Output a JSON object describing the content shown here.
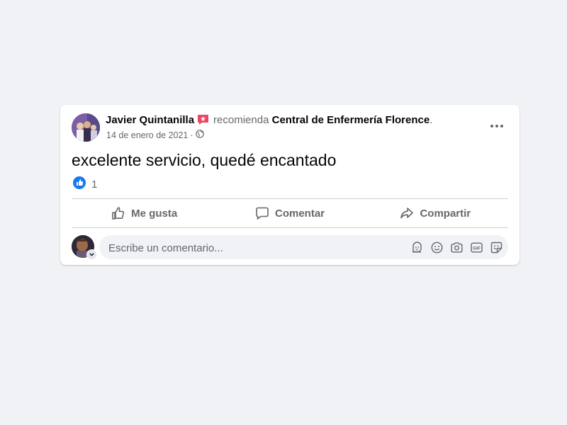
{
  "post": {
    "author": "Javier Quintanilla",
    "verb": "recomienda",
    "page_name": "Central de Enfermería Florence",
    "period": ".",
    "date": "14 de enero de 2021",
    "date_separator": "·",
    "privacy_icon": "globe-icon",
    "text": "excelente servicio, quedé encantado",
    "reaction_icon": "like-icon",
    "reaction_count": "1"
  },
  "actions": {
    "like": "Me gusta",
    "comment": "Comentar",
    "share": "Compartir"
  },
  "comment": {
    "placeholder": "Escribe un comentario...",
    "icons": [
      "avatar-sticker-icon",
      "emoji-icon",
      "camera-icon",
      "gif-icon",
      "sticker-icon"
    ]
  },
  "colors": {
    "background": "#f0f2f5",
    "card": "#ffffff",
    "like_blue": "#1877f2",
    "secondary_text": "#65676b",
    "badge_pink": "#f3425f"
  }
}
